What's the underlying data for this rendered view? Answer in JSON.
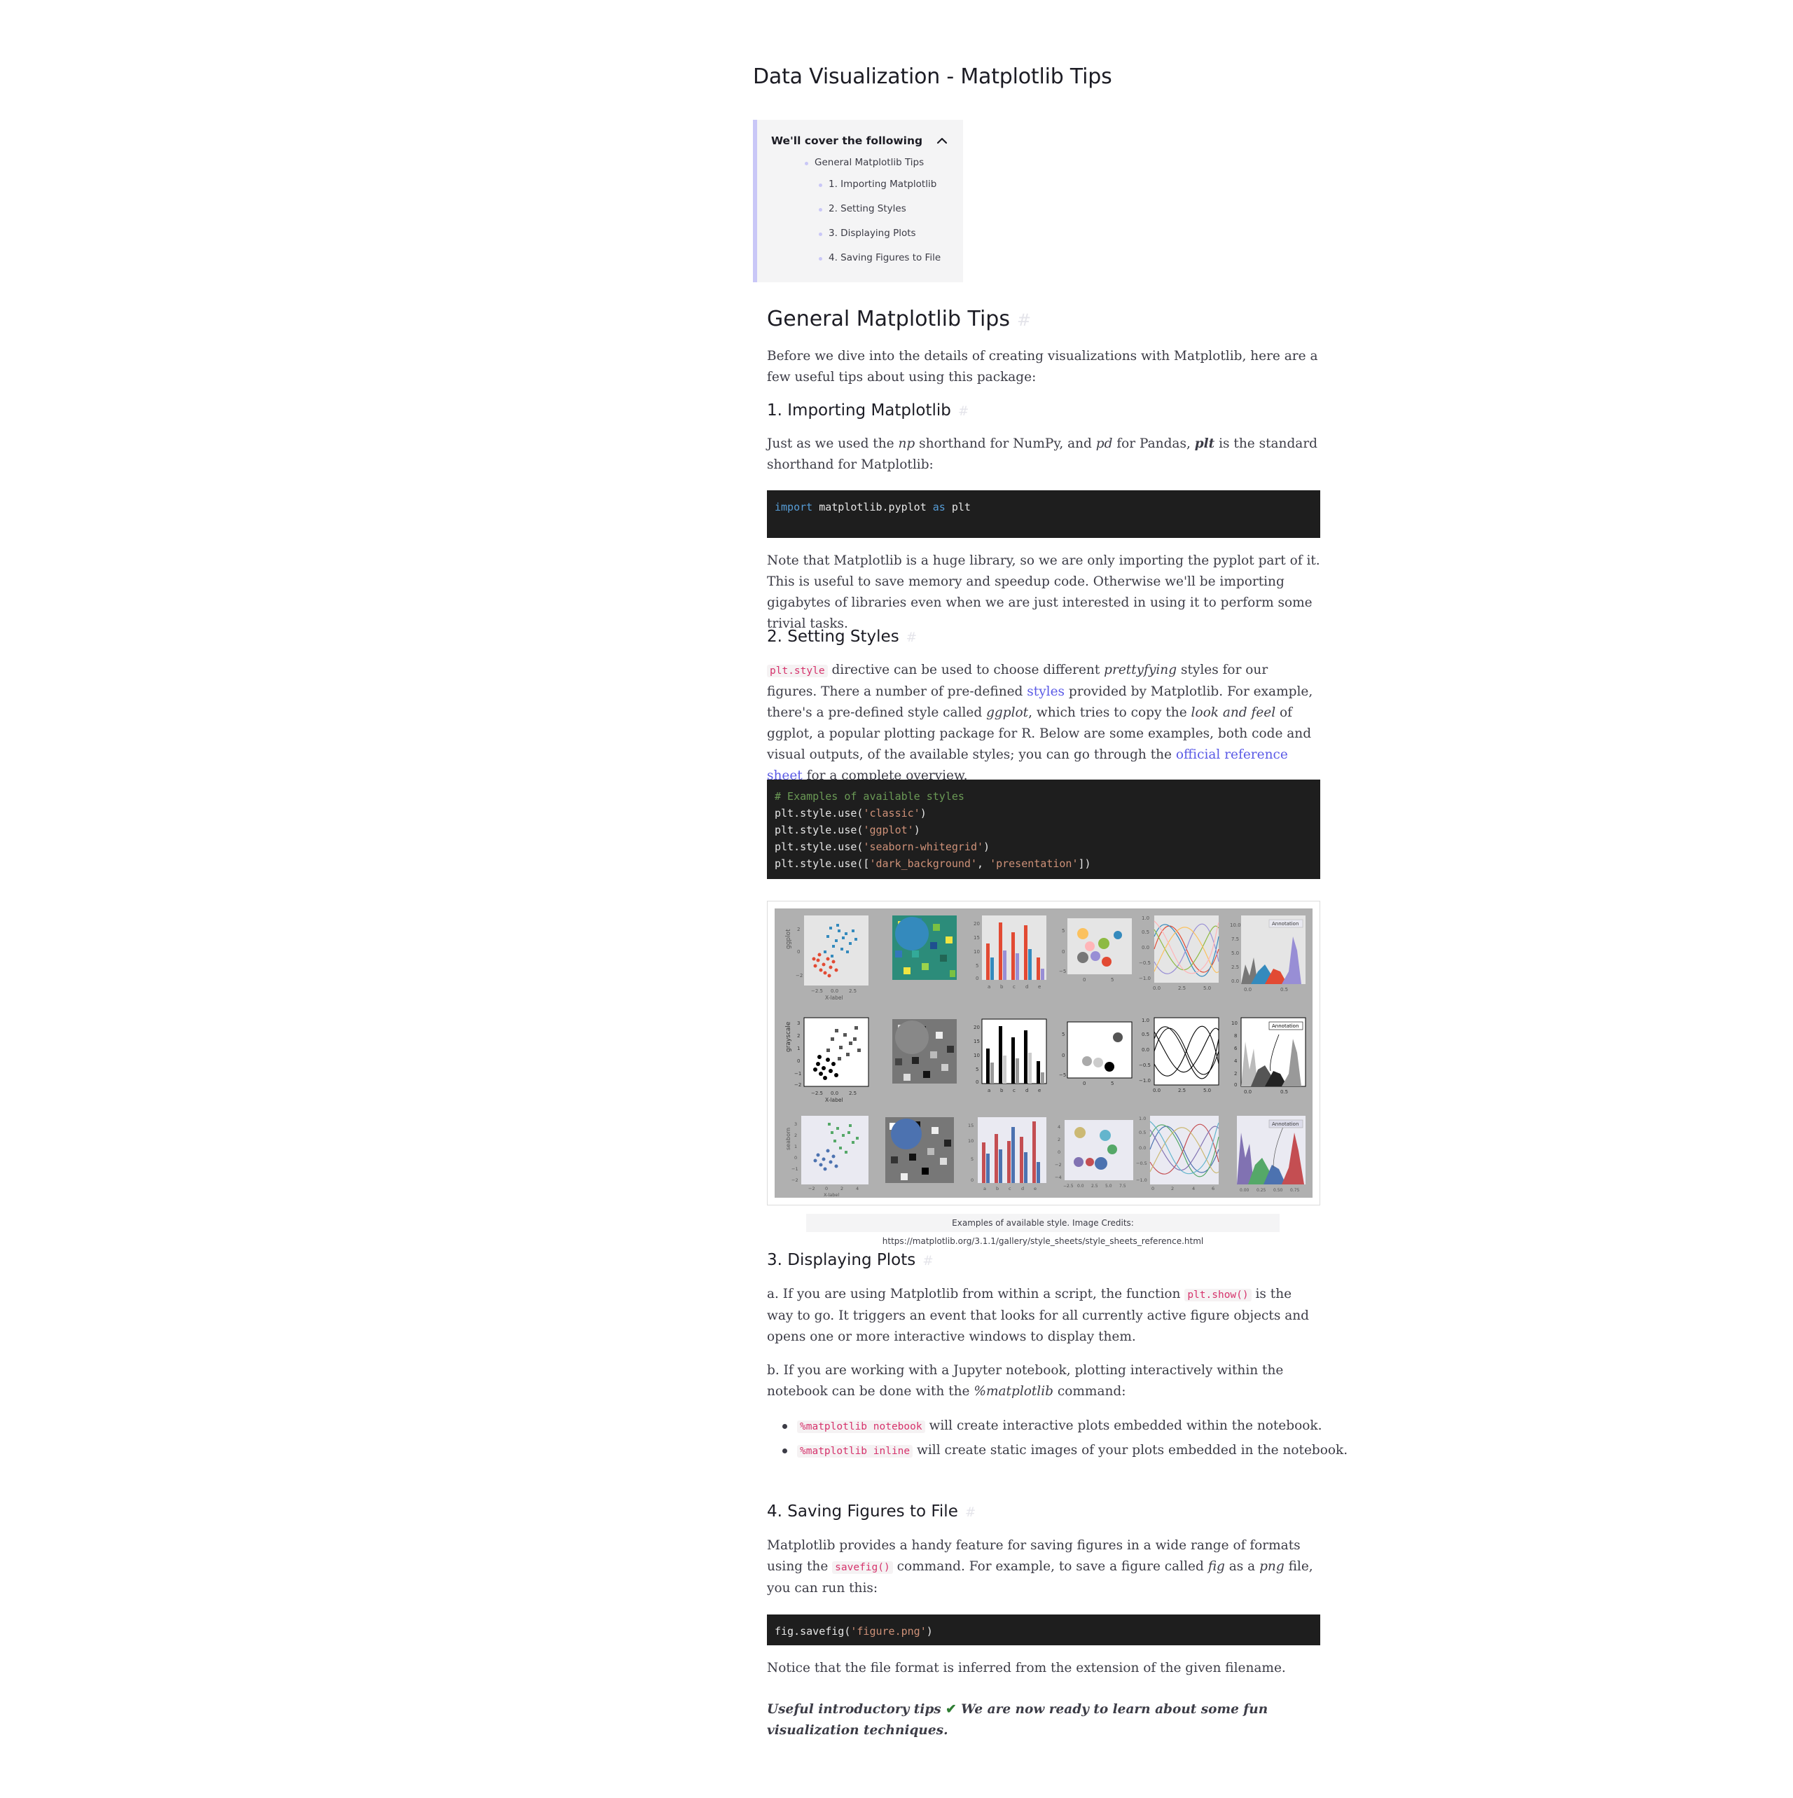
{
  "document": {
    "title": "Data Visualization - Matplotlib Tips"
  },
  "toc": {
    "heading": "We'll cover the following",
    "items": [
      {
        "label": "General Matplotlib Tips",
        "level": 1
      },
      {
        "label": "1. Importing Matplotlib",
        "level": 2
      },
      {
        "label": "2. Setting Styles",
        "level": 2
      },
      {
        "label": "3. Displaying Plots",
        "level": 2
      },
      {
        "label": "4. Saving Figures to File",
        "level": 2
      }
    ]
  },
  "general": {
    "heading": "General Matplotlib Tips",
    "anchor": "#",
    "intro": "Before we dive into the details of creating visualizations with Matplotlib, here are a few useful tips about using this package:"
  },
  "importing": {
    "heading": "1. Importing Matplotlib",
    "anchor": "#",
    "p1_a": "Just as we used the ",
    "p1_np": "np",
    "p1_b": " shorthand for NumPy, and ",
    "p1_pd": "pd",
    "p1_c": " for Pandas, ",
    "p1_plt": "plt",
    "p1_d": " is the standard shorthand for Matplotlib:",
    "code_kw1": "import",
    "code_mid": " matplotlib.pyplot ",
    "code_kw2": "as",
    "code_end": " plt",
    "note": "Note that Matplotlib is a huge library, so we are only importing the pyplot part of it. This is useful to save memory and speedup code. Otherwise we'll be importing gigabytes of libraries even when we are just interested in using it to perform some trivial tasks."
  },
  "styles": {
    "heading": "2. Setting Styles",
    "anchor": "#",
    "code_inline": "plt.style",
    "t1": " directive can be used to choose different ",
    "t_pretty": "prettyfying",
    "t2": " styles for our figures. There a number of pre-defined ",
    "link_styles": "styles",
    "t3": " provided by Matplotlib. For example, there's a pre-defined style called ",
    "t_ggplot": "ggplot",
    "t4": ", which tries to copy the ",
    "t_look": "look and feel",
    "t5": " of ggplot, a popular plotting package for R. Below are some examples, both code and visual outputs, of the available styles; you can go through the ",
    "link_ref": "official reference sheet",
    "t6": " for a complete overview.",
    "code_comment": "# Examples of available styles",
    "code_lines": [
      {
        "pre": "plt.style.use(",
        "str": "'classic'",
        "post": ")"
      },
      {
        "pre": "plt.style.use(",
        "str": "'ggplot'",
        "post": ")"
      },
      {
        "pre": "plt.style.use(",
        "str": "'seaborn-whitegrid'",
        "post": ")"
      },
      {
        "pre": "plt.style.use([",
        "str": "'dark_background'",
        "mid": ", ",
        "str2": "'presentation'",
        "post": "])"
      }
    ],
    "figure": {
      "row_labels": [
        "ggplot",
        "grayscale",
        "seaborn"
      ],
      "xlabel": "X-label",
      "annotation": "Annotation",
      "bar_ticks": [
        "a",
        "b",
        "c",
        "d",
        "e"
      ],
      "row1_scatter_xticks": [
        "−2.5",
        "0.0",
        "2.5"
      ],
      "row1_scatter_yticks": [
        "2",
        "0",
        "−2"
      ],
      "row1_bar_yticks": [
        "20",
        "15",
        "10",
        "5",
        "0"
      ],
      "row1_circ_yticks": [
        "5",
        "0",
        "−5"
      ],
      "row1_circ_xticks": [
        "0",
        "5"
      ],
      "row1_sine_yticks": [
        "1.0",
        "0.5",
        "0.0",
        "−0.5",
        "−1.0"
      ],
      "row1_sine_xticks": [
        "0.0",
        "2.5",
        "5.0"
      ],
      "row1_hist_yticks": [
        "10.0",
        "7.5",
        "5.0",
        "2.5",
        "0.0"
      ],
      "row1_hist_xticks": [
        "0.0",
        "0.5"
      ],
      "row2_scatter_yticks": [
        "3",
        "2",
        "1",
        "0",
        "−1",
        "−2"
      ],
      "row2_hist_yticks": [
        "10",
        "8",
        "6",
        "4",
        "2",
        "0"
      ],
      "row3_scatter_xticks": [
        "−2",
        "0",
        "2",
        "4"
      ],
      "row3_scatter_yticks": [
        "3",
        "2",
        "1",
        "0",
        "−1",
        "−2"
      ],
      "row3_bar_yticks": [
        "15",
        "10",
        "5",
        "0"
      ],
      "row3_circ_xticks": [
        "−2.5",
        "0.0",
        "2.5",
        "5.0",
        "7.5"
      ],
      "row3_circ_yticks": [
        "4",
        "2",
        "0",
        "−2",
        "−4"
      ],
      "row3_sine_xticks": [
        "0",
        "2",
        "4",
        "6"
      ],
      "row3_hist_xticks": [
        "0.00",
        "0.25",
        "0.50",
        "0.75"
      ]
    },
    "caption": "Examples of available style. Image Credits: https://matplotlib.org/3.1.1/gallery/style_sheets/style_sheets_reference.html"
  },
  "displaying": {
    "heading": "3. Displaying Plots",
    "anchor": "#",
    "a1": "a. If you are using Matplotlib from within a script, the function ",
    "a_code": "plt.show()",
    "a2": " is the way to go. It triggers an event that looks for all currently active figure objects and opens one or more interactive windows to display them.",
    "b1": "b. If you are working with a Jupyter notebook, plotting interactively within the notebook can be done with the ",
    "b_cmd": "%matplotlib",
    "b2": " command:",
    "bullets": [
      {
        "code": "%matplotlib notebook",
        "text": " will create interactive plots embedded within the notebook."
      },
      {
        "code": "%matplotlib inline",
        "text": " will create static images of your plots embedded in the notebook."
      }
    ]
  },
  "saving": {
    "heading": "4. Saving Figures to File",
    "anchor": "#",
    "t1": "Matplotlib provides a handy feature for saving figures in a wide range of formats using the ",
    "code_inline": "savefig()",
    "t2": " command. For example, to save a figure called ",
    "t_fig": "fig",
    "t3": " as a ",
    "t_png": "png",
    "t4": " file, you can run this:",
    "code_pre": "fig.savefig(",
    "code_str": "'figure.png'",
    "code_post": ")",
    "notice": "Notice that the file format is inferred from the extension of the given filename.",
    "closing_a": "Useful introductory tips ",
    "closing_check": "✔",
    "closing_b": " We are now ready to learn about some fun visualization techniques."
  },
  "colors": {
    "accent": "#5a5ae6",
    "toc_border": "#c9c7f7",
    "code_bg": "#1e1e1e",
    "inline_code": "#d6336c",
    "check": "#2e7d32"
  }
}
